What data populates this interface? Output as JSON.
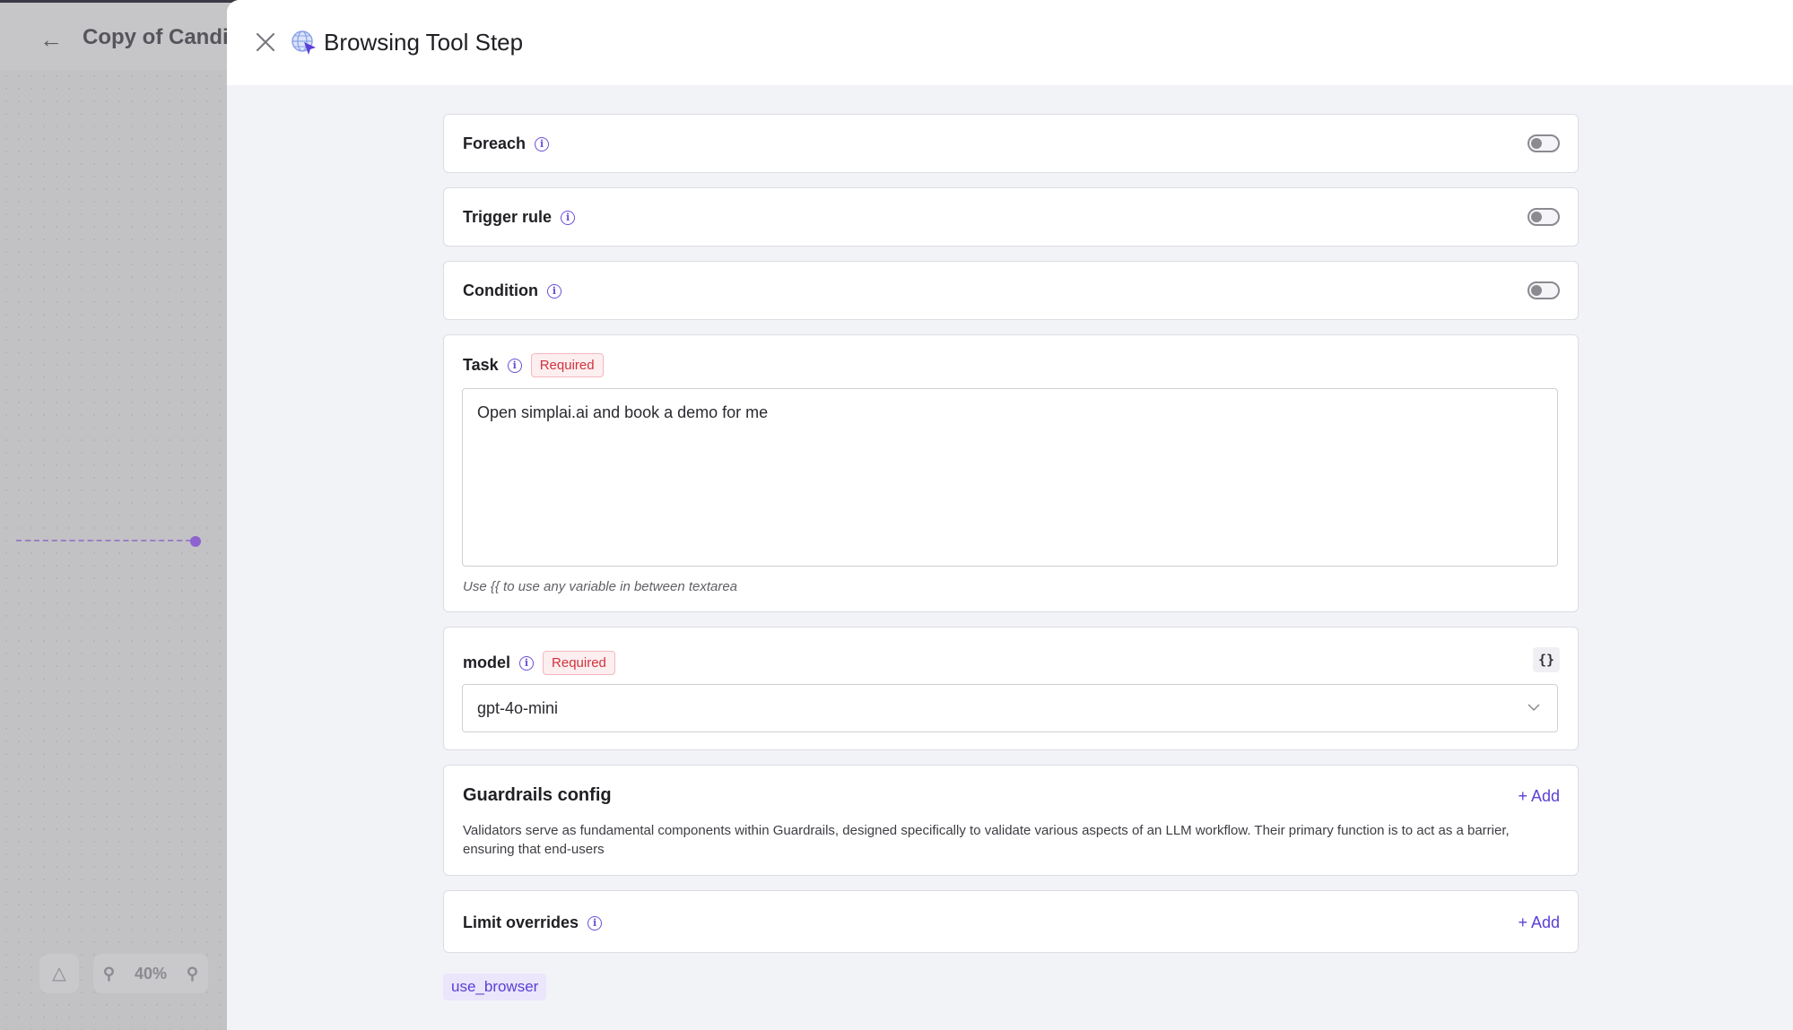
{
  "background": {
    "back_icon": "arrow-left-icon",
    "title": "Copy of Candi",
    "zoom_level": "40%"
  },
  "drawer": {
    "title": "Browsing Tool Step",
    "close_icon": "close-icon",
    "header_icon": "globe-cursor-icon"
  },
  "foreach": {
    "label": "Foreach",
    "enabled": false
  },
  "trigger_rule": {
    "label": "Trigger rule",
    "enabled": false
  },
  "condition": {
    "label": "Condition",
    "enabled": false
  },
  "task": {
    "label": "Task",
    "required_badge": "Required",
    "value": "Open simplai.ai and book a demo for me",
    "hint": "Use {{ to use any variable in between textarea"
  },
  "model": {
    "label": "model",
    "required_badge": "Required",
    "braces_label": "{}",
    "selected": "gpt-4o-mini"
  },
  "guardrails": {
    "title": "Guardrails config",
    "add_label": "+ Add",
    "description": "Validators serve as fundamental components within Guardrails, designed specifically to validate various aspects of an LLM workflow. Their primary function is to act as a barrier, ensuring that end-users"
  },
  "limit_overrides": {
    "label": "Limit overrides",
    "add_label": "+ Add"
  },
  "tool_tag": "use_browser",
  "colors": {
    "accent": "#5b3fd6",
    "required": "#d0343c",
    "panel_bg": "#f2f3f7"
  }
}
